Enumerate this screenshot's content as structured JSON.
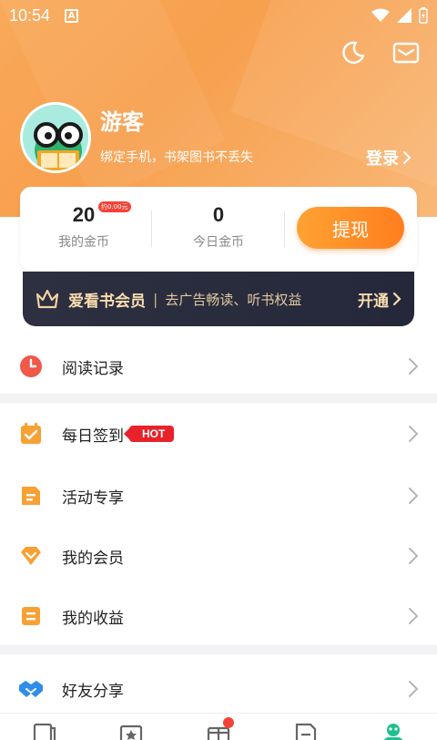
{
  "status_bar": {
    "time": "10:54",
    "app_badge": "A",
    "icons": [
      "wifi-icon",
      "signal-icon",
      "battery-icon"
    ]
  },
  "header": {
    "icons": [
      "moon-icon",
      "mail-icon"
    ],
    "user_name": "游客",
    "user_hint": "绑定手机，书架图书不丢失",
    "login_label": "登录"
  },
  "coins": {
    "my_coins_value": "20",
    "my_coins_badge": "约0.00元",
    "my_coins_label": "我的金币",
    "today_coins_value": "0",
    "today_coins_label": "今日金币",
    "withdraw_label": "提现"
  },
  "vip": {
    "title": "爱看书会员",
    "separator": "|",
    "description": "去广告畅读、听书权益",
    "open_label": "开通"
  },
  "menu": {
    "reading_history": "阅读记录",
    "daily_checkin": "每日签到",
    "hot_badge": "HOT",
    "activities": "活动专享",
    "my_membership": "我的会员",
    "my_earnings": "我的收益",
    "share_friends": "好友分享"
  },
  "tabbar": {
    "tabs": [
      "bookshelf-icon",
      "ranking-icon",
      "gift-icon",
      "category-icon",
      "profile-icon"
    ],
    "active": "profile-icon",
    "accent": "#1fbf8f"
  },
  "colors": {
    "header_gradient": "#f9a95a",
    "withdraw_button": "#ff8a22",
    "vip_bar": "#2a2d3e",
    "hot_badge": "#e8222b"
  }
}
